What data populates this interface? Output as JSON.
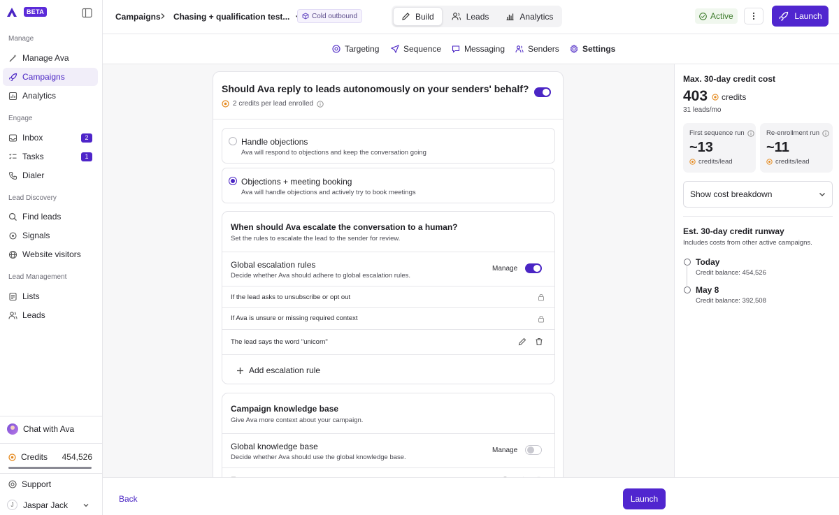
{
  "app": {
    "badge": "BETA"
  },
  "sidebar": {
    "sections": [
      {
        "label": "Manage",
        "items": [
          {
            "label": "Manage Ava",
            "icon": "wand-icon"
          },
          {
            "label": "Campaigns",
            "icon": "rocket-icon",
            "active": true
          },
          {
            "label": "Analytics",
            "icon": "chart-icon"
          }
        ]
      },
      {
        "label": "Engage",
        "items": [
          {
            "label": "Inbox",
            "icon": "inbox-icon",
            "badge": "2"
          },
          {
            "label": "Tasks",
            "icon": "checklist-icon",
            "badge": "1"
          },
          {
            "label": "Dialer",
            "icon": "phone-icon"
          }
        ]
      },
      {
        "label": "Lead Discovery",
        "items": [
          {
            "label": "Find leads",
            "icon": "search-icon"
          },
          {
            "label": "Signals",
            "icon": "signal-icon"
          },
          {
            "label": "Website visitors",
            "icon": "globe-icon"
          }
        ]
      },
      {
        "label": "Lead Management",
        "items": [
          {
            "label": "Lists",
            "icon": "list-icon"
          },
          {
            "label": "Leads",
            "icon": "people-icon"
          }
        ]
      }
    ],
    "chat_label": "Chat with Ava",
    "credits_label": "Credits",
    "credits_value": "454,526",
    "credits_fraction": 1.0,
    "support_label": "Support",
    "user_initial": "J",
    "user_name": "Jaspar Jack"
  },
  "header": {
    "crumb_root": "Campaigns",
    "crumb_campaign": "Chasing + qualification test...",
    "tag": "Cold outbound",
    "modes": [
      {
        "label": "Build",
        "icon": "pencil-icon",
        "active": true
      },
      {
        "label": "Leads",
        "icon": "people-icon"
      },
      {
        "label": "Analytics",
        "icon": "chart-icon"
      }
    ],
    "status": "Active",
    "launch_label": "Launch"
  },
  "subnav": {
    "tabs": [
      {
        "label": "Targeting",
        "icon": "target-icon"
      },
      {
        "label": "Sequence",
        "icon": "send-icon"
      },
      {
        "label": "Messaging",
        "icon": "message-icon"
      },
      {
        "label": "Senders",
        "icon": "people-icon"
      },
      {
        "label": "Settings",
        "icon": "gear-icon",
        "active": true
      }
    ]
  },
  "main": {
    "question": "Should Ava reply to leads autonomously on your senders' behalf?",
    "question_toggle": true,
    "credits_note": "2 credits per lead enrolled",
    "options": [
      {
        "title": "Handle objections",
        "desc": "Ava will respond to objections and keep the conversation going",
        "selected": false
      },
      {
        "title": "Objections + meeting booking",
        "desc": "Ava will handle objections and actively try to book meetings",
        "selected": true
      }
    ],
    "escalation": {
      "title": "When should Ava escalate the conversation to a human?",
      "desc": "Set the rules to escalate the lead to the sender for review.",
      "global_title": "Global escalation rules",
      "global_desc": "Decide whether Ava should adhere to global escalation rules.",
      "manage": "Manage",
      "global_toggle": true,
      "rules": [
        {
          "text": "If the lead asks to unsubscribe or opt out",
          "locked": true
        },
        {
          "text": "If Ava is unsure or missing required context",
          "locked": true
        },
        {
          "text": "The lead says the word \"unicorn\"",
          "locked": false
        }
      ],
      "add_label": "Add escalation rule"
    },
    "knowledge": {
      "title": "Campaign knowledge base",
      "desc": "Give Ava more context about your campaign.",
      "global_title": "Global knowledge base",
      "global_desc": "Decide whether Ava should use the global knowledge base.",
      "manage": "Manage",
      "global_toggle": false
    }
  },
  "footer": {
    "back_label": "Back",
    "launch_label": "Launch"
  },
  "right": {
    "title": "Max. 30-day credit cost",
    "value": "403",
    "unit": "credits",
    "sub": "31 leads/mo",
    "stats": [
      {
        "label": "First sequence run",
        "value": "~13",
        "unit": "credits/lead"
      },
      {
        "label": "Re-enrollment run",
        "value": "~11",
        "unit": "credits/lead"
      }
    ],
    "breakdown_label": "Show cost breakdown",
    "runway_title": "Est. 30-day credit runway",
    "runway_sub": "Includes costs from other active campaigns.",
    "timeline": [
      {
        "label": "Today",
        "balance": "Credit balance: 454,526"
      },
      {
        "label": "May 8",
        "balance": "Credit balance: 392,508"
      }
    ]
  },
  "colors": {
    "accent": "#5026cf",
    "active_green": "#3f7d2e",
    "credit_orange": "#e58a1f"
  }
}
